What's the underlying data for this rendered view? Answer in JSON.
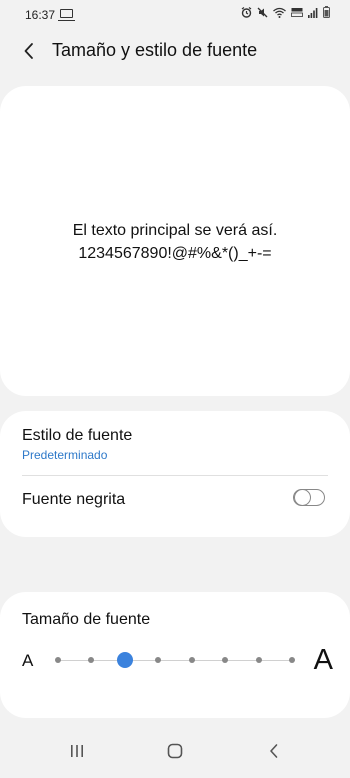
{
  "status_bar": {
    "time": "16:37",
    "icons": [
      "screen-cast-icon",
      "alarm-icon",
      "mute-icon",
      "wifi-icon",
      "volte-icon",
      "signal-icon",
      "battery-icon"
    ]
  },
  "header": {
    "title": "Tamaño y estilo de fuente",
    "back_icon": "chevron-left-icon"
  },
  "preview": {
    "line1": "El texto principal se verá así.",
    "line2": "1234567890!@#%&*()_+-="
  },
  "font_style": {
    "title": "Estilo de fuente",
    "value": "Predeterminado"
  },
  "bold_font": {
    "label": "Fuente negrita",
    "enabled": false
  },
  "font_size": {
    "title": "Tamaño de fuente",
    "min_label": "A",
    "max_label": "A",
    "steps": 8,
    "selected_index": 2
  },
  "colors": {
    "accent": "#3b82dd",
    "link": "#2e79c9",
    "background": "#f2f2f2",
    "card": "#ffffff"
  },
  "nav_bar": {
    "buttons": [
      "recents-icon",
      "home-icon",
      "back-icon"
    ]
  }
}
